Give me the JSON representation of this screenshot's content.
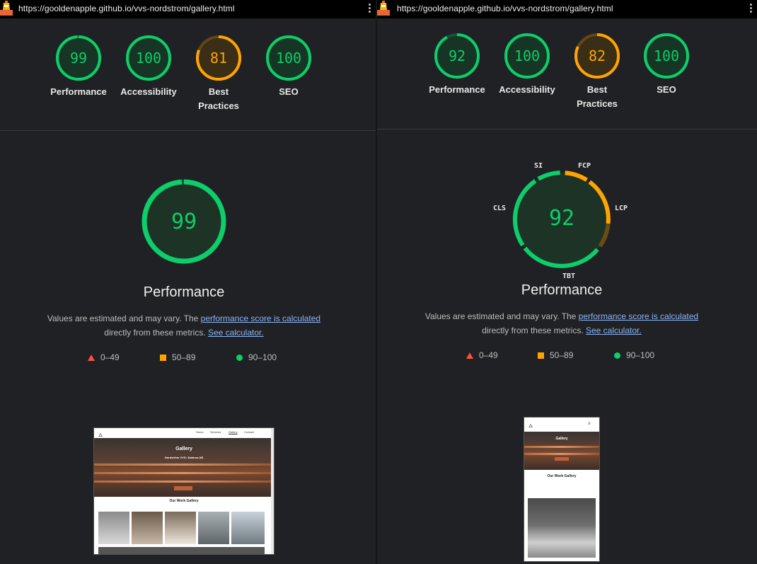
{
  "colors": {
    "good": "#0cce6b",
    "average": "#ffa400",
    "poor": "#ff4e42",
    "track_good": "#0cce6b",
    "link": "#8ab4f8"
  },
  "left": {
    "url": "https://gooldenapple.github.io/vvs-nordstrom/gallery.html",
    "scores": [
      {
        "value": "99",
        "label": "Performance",
        "score": 0.99,
        "rating": "good"
      },
      {
        "value": "100",
        "label": "Accessibility",
        "score": 1.0,
        "rating": "good"
      },
      {
        "value": "81",
        "label": "Best Practices",
        "score": 0.81,
        "rating": "average"
      },
      {
        "value": "100",
        "label": "SEO",
        "score": 1.0,
        "rating": "good"
      }
    ],
    "main_score": "99",
    "main_label": "Performance",
    "desc_before": "Values are estimated and may vary. The ",
    "desc_link1": "performance score is calculated",
    "desc_middle": "directly from these metrics. ",
    "desc_link2": "See calculator.",
    "legend": [
      "0–49",
      "50–89",
      "90–100"
    ],
    "thumb": {
      "nav": [
        "Home",
        "Services",
        "Gallery",
        "Contact"
      ],
      "hero_title": "Gallery",
      "hero_sub": "Nordström VVS i Dalarna AB",
      "section_title": "Our Work Gallery"
    }
  },
  "right": {
    "url": "https://gooldenapple.github.io/vvs-nordstrom/gallery.html",
    "scores": [
      {
        "value": "92",
        "label": "Performance",
        "score": 0.92,
        "rating": "good"
      },
      {
        "value": "100",
        "label": "Accessibility",
        "score": 1.0,
        "rating": "good"
      },
      {
        "value": "82",
        "label": "Best Practices",
        "score": 0.82,
        "rating": "average"
      },
      {
        "value": "100",
        "label": "SEO",
        "score": 1.0,
        "rating": "good"
      }
    ],
    "main_score": "92",
    "main_label": "Performance",
    "metrics": [
      "SI",
      "FCP",
      "LCP",
      "TBT",
      "CLS"
    ],
    "desc_before": "Values are estimated and may vary. The ",
    "desc_link1": "performance score is calculated",
    "desc_middle": "directly from these metrics. ",
    "desc_link2": "See calculator.",
    "legend": [
      "0–49",
      "50–89",
      "90–100"
    ],
    "thumb": {
      "hero_title": "Gallery",
      "section_title": "Our Work Gallery"
    }
  }
}
